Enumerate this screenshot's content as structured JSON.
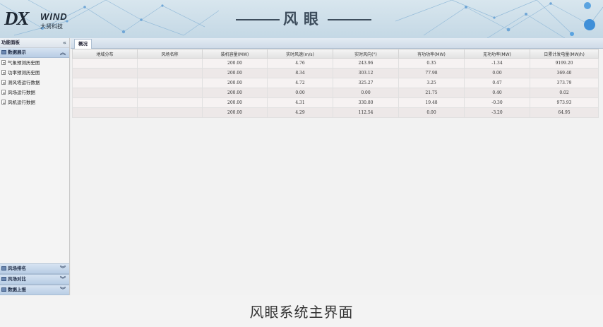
{
  "header": {
    "logo_mark": "DX",
    "logo_wind": "WIND",
    "logo_cn": "大贤科技",
    "title": "风眼"
  },
  "sidebar": {
    "panel_title": "功能面板",
    "collapse_glyph": "«",
    "sections": [
      {
        "label": "数据展示",
        "expanded": true,
        "items": [
          "气象预测历史图",
          "功率预测历史图",
          "测风塔运行数据",
          "风场运行数据",
          "风机运行数据"
        ]
      }
    ],
    "bottom_sections": [
      "风场排名",
      "风场对比",
      "数据上报"
    ]
  },
  "main": {
    "tabs": [
      "概况"
    ],
    "table": {
      "columns": [
        "地域分布",
        "风场名称",
        "装机容量(MW)",
        "实时风速(m/s)",
        "实时风向(°)",
        "有功功率(MW)",
        "无功功率(MW)",
        "日累计发电量(MW/h)"
      ],
      "rows": [
        [
          "",
          "",
          "200.00",
          "4.76",
          "243.96",
          "0.35",
          "-1.34",
          "9199.20"
        ],
        [
          "",
          "",
          "200.00",
          "8.34",
          "303.12",
          "77.98",
          "0.00",
          "369.40"
        ],
        [
          "",
          "",
          "200.00",
          "4.72",
          "325.27",
          "3.25",
          "0.47",
          "373.79"
        ],
        [
          "",
          "",
          "200.00",
          "0.00",
          "0.00",
          "21.75",
          "0.40",
          "0.02"
        ],
        [
          "",
          "",
          "200.00",
          "4.31",
          "330.80",
          "19.48",
          "-0.30",
          "973.93"
        ],
        [
          "",
          "",
          "200.00",
          "4.29",
          "112.54",
          "0.00",
          "-3.20",
          "64.95"
        ]
      ]
    }
  },
  "caption": "风眼系统主界面"
}
